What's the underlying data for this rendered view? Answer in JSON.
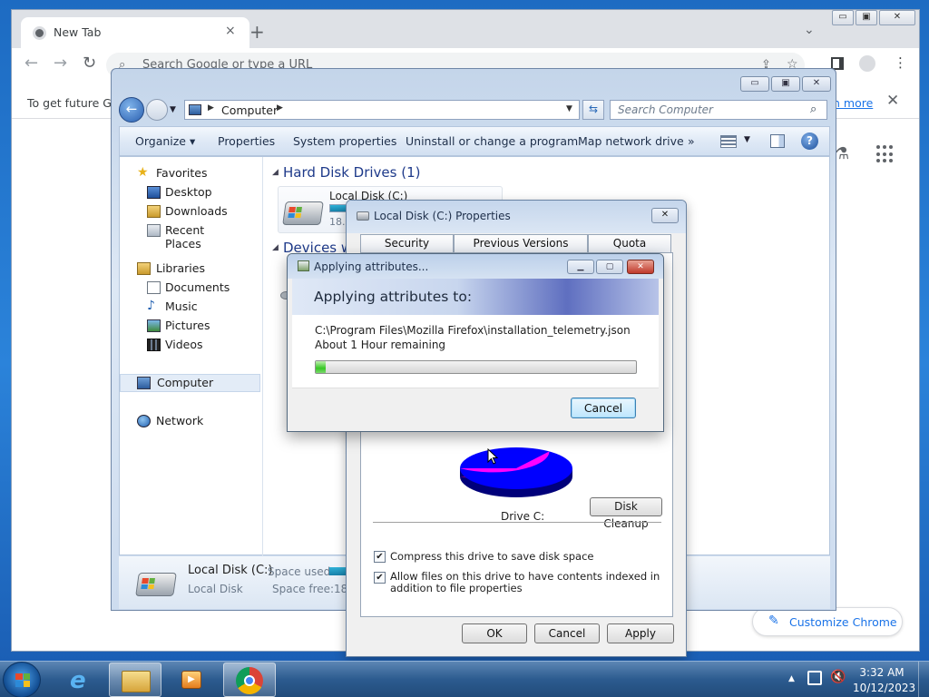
{
  "chrome": {
    "tab_title": "New Tab",
    "tab_close": "×",
    "new_tab": "+",
    "tab_search": "⌄",
    "omnibox_placeholder": "Search Google or type a URL",
    "info_text": "To get future Go",
    "info_link": "n more",
    "info_close": "✕",
    "customize_label": "Customize Chrome"
  },
  "explorer": {
    "address": "Computer",
    "search_placeholder": "Search Computer",
    "toolbar": [
      "Organize ▾",
      "Properties",
      "System properties",
      "Uninstall or change a program",
      "Map network drive",
      "»"
    ],
    "nav": {
      "favorites": "Favorites",
      "desktop": "Desktop",
      "downloads": "Downloads",
      "recent": "Recent Places",
      "libraries": "Libraries",
      "documents": "Documents",
      "music": "Music",
      "pictures": "Pictures",
      "videos": "Videos",
      "computer": "Computer",
      "network": "Network"
    },
    "hdd_group": "Hard Disk Drives (1)",
    "devices_group": "Devices wi",
    "disk_name": "Local Disk (C:)",
    "disk_size_partial": "18.9",
    "status": {
      "name": "Local Disk (C:)",
      "type": "Local Disk",
      "space_used_label": "Space used:",
      "space_free_label": "Space free:",
      "space_free_partial": "18.9"
    }
  },
  "properties": {
    "title": "Local Disk (C:) Properties",
    "tabs": [
      "Security",
      "Previous Versions",
      "Quota"
    ],
    "drive_label": "Drive C:",
    "disk_cleanup": "Disk Cleanup",
    "compress_label": "Compress this drive to save disk space",
    "index_label": "Allow files on this drive to have contents indexed in addition to file properties",
    "ok": "OK",
    "cancel": "Cancel",
    "apply": "Apply",
    "used_fraction": 0.35
  },
  "applying": {
    "title": "Applying attributes...",
    "heading": "Applying attributes to:",
    "path": "C:\\Program Files\\Mozilla Firefox\\installation_telemetry.json",
    "remaining": "About 1 Hour remaining",
    "progress_fraction": 0.03,
    "cancel": "Cancel"
  },
  "taskbar": {
    "time": "3:32 AM",
    "date": "10/12/2023"
  },
  "colors": {
    "used_space": "#ff00ff",
    "free_space": "#0000ff",
    "progress": "#37c724",
    "chrome_link": "#1a73e8"
  }
}
